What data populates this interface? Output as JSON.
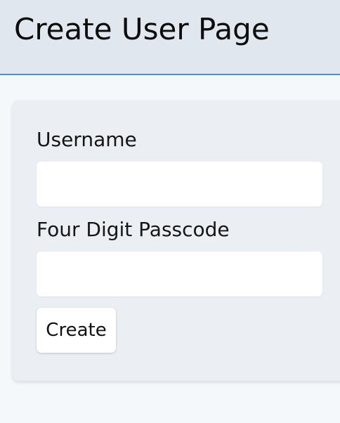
{
  "header": {
    "title": "Create User Page"
  },
  "form": {
    "username": {
      "label": "Username",
      "value": "",
      "placeholder": ""
    },
    "passcode": {
      "label": "Four Digit Passcode",
      "value": "",
      "placeholder": ""
    },
    "submit_label": "Create"
  },
  "colors": {
    "page_background": "#f4f8fb",
    "header_background": "#e1e7ef",
    "header_border": "#4a90d9",
    "card_background": "#ebeff4",
    "input_background": "#ffffff"
  }
}
